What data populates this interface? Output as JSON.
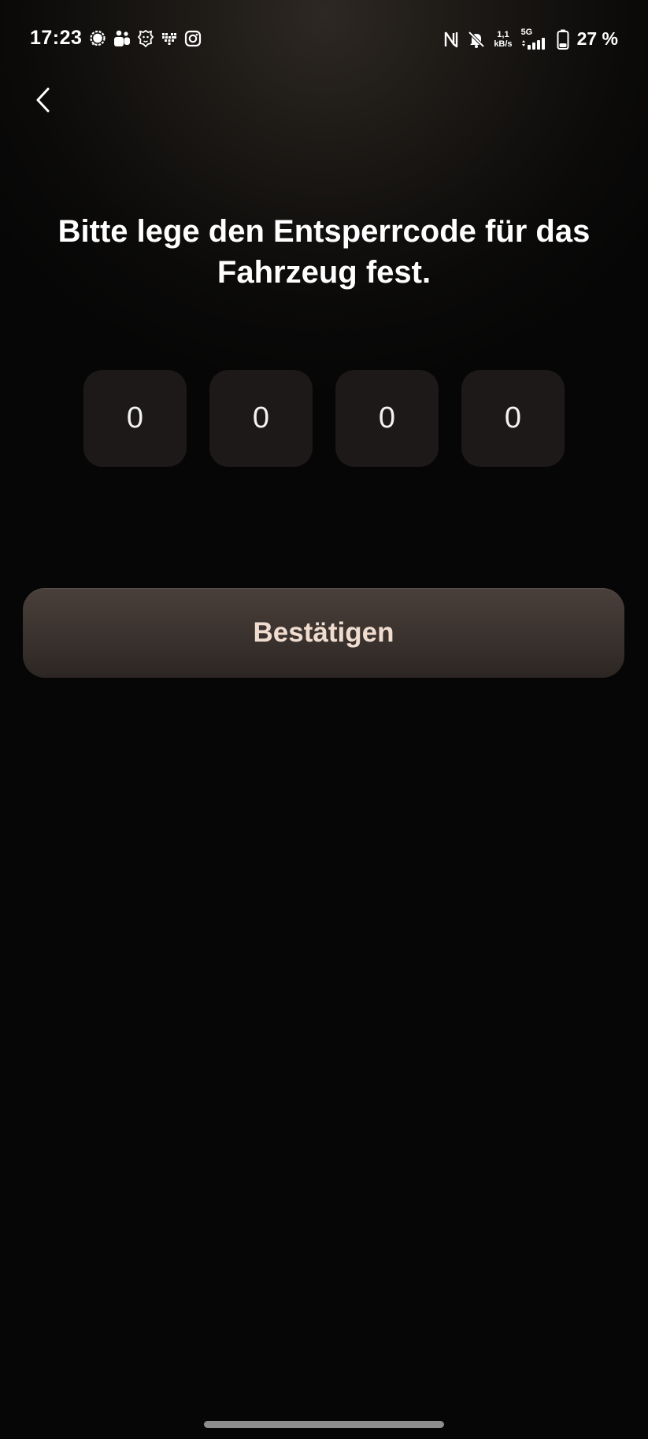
{
  "status_bar": {
    "time": "17:23",
    "left_icons": [
      "signal-messenger-icon",
      "teams-icon",
      "lion-app-icon",
      "heart-pixel-icon",
      "instagram-icon"
    ],
    "right_icons": [
      "nfc-icon",
      "bell-muted-icon",
      "signal-bars-icon",
      "battery-icon"
    ],
    "net_speed_value": "1,1",
    "net_speed_unit": "kB/s",
    "network_type": "5G",
    "battery_percent": "27 %",
    "battery_level": 0.27
  },
  "header": {
    "back_icon": "chevron-left-icon"
  },
  "main": {
    "title": "Bitte lege den Entsperrcode für das Fahrzeug fest.",
    "pin_digits": [
      "0",
      "0",
      "0",
      "0"
    ],
    "confirm_label": "Bestätigen"
  },
  "colors": {
    "background": "#060606",
    "pin_box": "#1d1918",
    "button_top": "#4a3f3a",
    "button_bottom": "#2c2623",
    "button_text": "#f0ddd0"
  }
}
